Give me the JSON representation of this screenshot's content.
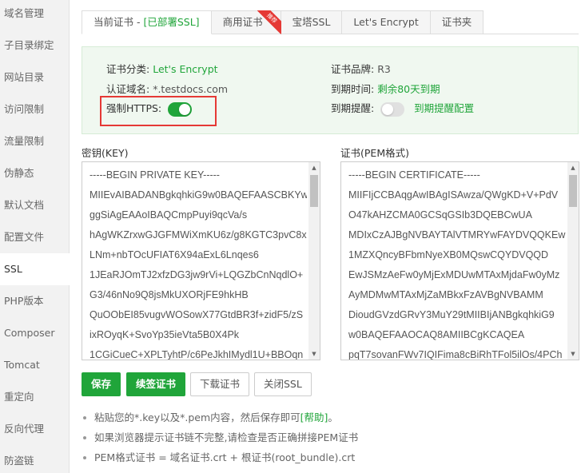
{
  "sidebar": {
    "items": [
      {
        "label": "域名管理"
      },
      {
        "label": "子目录绑定"
      },
      {
        "label": "网站目录"
      },
      {
        "label": "访问限制"
      },
      {
        "label": "流量限制"
      },
      {
        "label": "伪静态"
      },
      {
        "label": "默认文档"
      },
      {
        "label": "配置文件"
      },
      {
        "label": "SSL"
      },
      {
        "label": "PHP版本"
      },
      {
        "label": "Composer"
      },
      {
        "label": "Tomcat"
      },
      {
        "label": "重定向"
      },
      {
        "label": "反向代理"
      },
      {
        "label": "防盗链"
      }
    ],
    "active": "SSL"
  },
  "tabs": {
    "current_prefix": "当前证书 - ",
    "current_status": "[已部署SSL]",
    "commercial": "商用证书",
    "commercial_badge": "推荐",
    "baota": "宝塔SSL",
    "letsencrypt": "Let's Encrypt",
    "folder": "证书夹"
  },
  "cert_info": {
    "category_label": "证书分类:",
    "category_value": "Let's Encrypt",
    "domain_label": "认证域名:",
    "domain_value": "*.testdocs.com",
    "force_https_label": "强制HTTPS:",
    "force_https_on": true,
    "brand_label": "证书品牌:",
    "brand_value": "R3",
    "expiry_label": "到期时间:",
    "expiry_value": "剩余80天到期",
    "reminder_label": "到期提醒:",
    "reminder_on": false,
    "reminder_link": "到期提醒配置"
  },
  "key": {
    "label": "密钥(KEY)",
    "lines": [
      "-----BEGIN PRIVATE KEY-----",
      "MIIEvAIBADANBgkqhkiG9w0BAQEFAASCBKYw",
      "ggSiAgEAAoIBAQCmpPuyi9qcVa/s",
      "hAgWKZrxwGJGFMWiXmKU6z/g8KGTC3pvC8x",
      "LNm+nbTOcUFIAT6X94aExL6Lnqes6",
      "1JEaRJOmTJ2xfzDG3jw9rVi+LQGZbCnNqdlO+",
      "G3/46nNo9Q8jsMkUXORjFE9hkHB",
      "QuOObEI85vugvWOSowX77GtdBR3f+zidF5/zS",
      "ixROyqK+SvoYp35ieVta5B0X4Pk",
      "1CGiCueC+XPLTyhtP/c6PeJkhIMydl1U+BBOqn"
    ]
  },
  "cert": {
    "label": "证书(PEM格式)",
    "lines": [
      "-----BEGIN CERTIFICATE-----",
      "MIIFIjCCBAqgAwIBAgISAwza/QWgKD+V+PdV",
      "O47kAHZCMA0GCSqGSIb3DQEBCwUA",
      "MDIxCzAJBgNVBAYTAlVTMRYwFAYDVQQKEw",
      "1MZXQncyBFbmNyeXB0MQswCQYDVQQD",
      "EwJSMzAeFw0yMjExMDUwMTAxMjdaFw0yMz",
      "AyMDMwMTAxMjZaMBkxFzAVBgNVBAMM",
      "DioudGVzdGRvY3MuY29tMIIBIjANBgkqhkiG9",
      "w0BAQEFAAOCAQ8AMIIBCgKCAQEA",
      "pqT7sovanFWv7IQIFima8cBiRhTFol5ilOs/4PCh"
    ]
  },
  "buttons": {
    "save": "保存",
    "renew": "续签证书",
    "download": "下载证书",
    "close_ssl": "关闭SSL"
  },
  "notes": {
    "n1_text": "粘贴您的*.key以及*.pem内容，然后保存即可",
    "n1_help": "[帮助]",
    "n1_end": "。",
    "n2": "如果浏览器提示证书链不完整,请检查是否正确拼接PEM证书",
    "n3": "PEM格式证书 = 域名证书.crt + 根证书(root_bundle).crt"
  },
  "colors": {
    "accent": "#20a53a",
    "highlight": "#e53935",
    "info_bg": "#f0f8f0"
  }
}
